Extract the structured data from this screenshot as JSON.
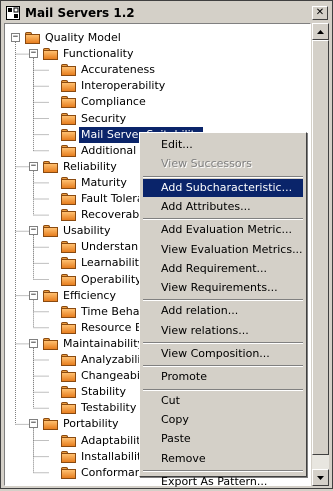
{
  "window": {
    "title": "Mail Servers 1.2",
    "close_glyph": "✕",
    "app_icon": "mail-server-app-icon"
  },
  "tree": {
    "root": "Quality Model",
    "groups": [
      {
        "label": "Functionality",
        "expanded": true,
        "children": [
          "Accurateness",
          "Interoperability",
          "Compliance",
          "Security",
          "Mail Server Suitability",
          "Additional S"
        ]
      },
      {
        "label": "Reliability",
        "expanded": true,
        "children": [
          "Maturity",
          "Fault Tolera",
          "Recoverab"
        ]
      },
      {
        "label": "Usability",
        "expanded": true,
        "children": [
          "Understan",
          "Learnabilit",
          "Operability"
        ]
      },
      {
        "label": "Efficiency",
        "expanded": true,
        "children": [
          "Time Behav",
          "Resource E"
        ]
      },
      {
        "label": "Maintainability",
        "expanded": true,
        "children": [
          "Analyzabili",
          "Changeabili",
          "Stability",
          "Testability"
        ]
      },
      {
        "label": "Portability",
        "expanded": true,
        "children": [
          "Adaptability",
          "Installability",
          "Conforman"
        ]
      }
    ],
    "selected": "Mail Server Suitability",
    "expander_glyph": "−"
  },
  "context_menu": {
    "items": [
      {
        "label": "Edit...",
        "disabled": false
      },
      {
        "label": "View Successors",
        "disabled": true
      },
      {
        "sep": true
      },
      {
        "label": "Add Subcharacteristic...",
        "highlight": true
      },
      {
        "label": "Add Attributes..."
      },
      {
        "sep": true
      },
      {
        "label": "Add Evaluation Metric..."
      },
      {
        "label": "View Evaluation Metrics..."
      },
      {
        "label": "Add Requirement..."
      },
      {
        "label": "View Requirements..."
      },
      {
        "sep": true
      },
      {
        "label": "Add relation..."
      },
      {
        "label": "View relations..."
      },
      {
        "sep": true
      },
      {
        "label": "View Composition..."
      },
      {
        "sep": true
      },
      {
        "label": "Promote"
      },
      {
        "sep": true
      },
      {
        "label": "Cut"
      },
      {
        "label": "Copy"
      },
      {
        "label": "Paste"
      },
      {
        "label": "Remove"
      },
      {
        "sep": true
      },
      {
        "label": "Export As Pattern..."
      }
    ]
  },
  "colors": {
    "selection": "#0a246a",
    "folder": "#f0a040",
    "window_bg": "#d4d0c8"
  }
}
